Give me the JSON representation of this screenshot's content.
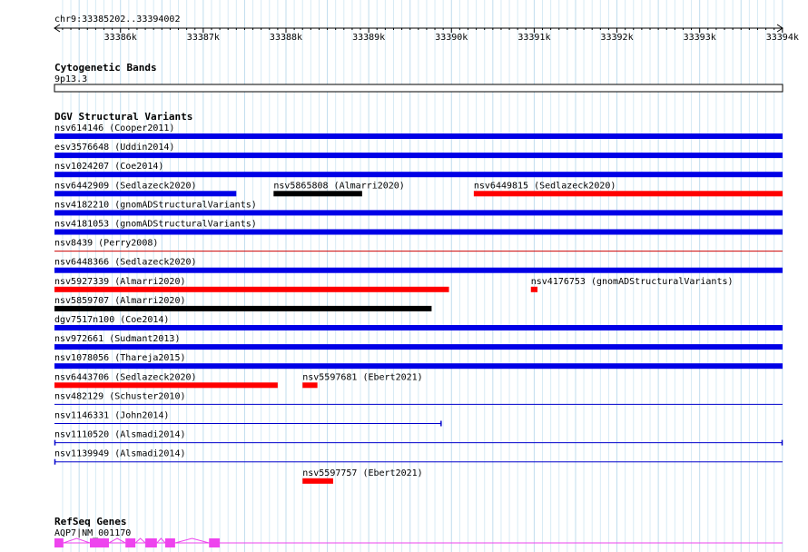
{
  "ruler": {
    "position": "chr9:33385202..33394002",
    "start": 33385202,
    "end": 33394002,
    "ticks": [
      {
        "pos": 33386000,
        "label": "33386k"
      },
      {
        "pos": 33387000,
        "label": "33387k"
      },
      {
        "pos": 33388000,
        "label": "33388k"
      },
      {
        "pos": 33389000,
        "label": "33389k"
      },
      {
        "pos": 33390000,
        "label": "33390k"
      },
      {
        "pos": 33391000,
        "label": "33391k"
      },
      {
        "pos": 33392000,
        "label": "33392k"
      },
      {
        "pos": 33393000,
        "label": "33393k"
      },
      {
        "pos": 33394000,
        "label": "33394k"
      }
    ]
  },
  "cytoband": {
    "title": "Cytogenetic Bands",
    "band": "9p13.3"
  },
  "dgv": {
    "title": "DGV Structural Variants",
    "rows": [
      {
        "features": [
          {
            "label": "nsv614146 (Cooper2011)",
            "start": 33385202,
            "end": 33394002,
            "color": "#0000e6",
            "style": "thick"
          }
        ]
      },
      {
        "features": [
          {
            "label": "esv3576648 (Uddin2014)",
            "start": 33385202,
            "end": 33394002,
            "color": "#0000e6",
            "style": "thick"
          }
        ]
      },
      {
        "features": [
          {
            "label": "nsv1024207 (Coe2014)",
            "start": 33385202,
            "end": 33394002,
            "color": "#0000e6",
            "style": "thick"
          }
        ]
      },
      {
        "features": [
          {
            "label": "nsv6442909 (Sedlazeck2020)",
            "start": 33385202,
            "end": 33387400,
            "color": "#0000e6",
            "style": "thick"
          },
          {
            "label": "nsv5865808 (Almarri2020)",
            "start": 33387850,
            "end": 33388920,
            "color": "#000000",
            "style": "thick"
          },
          {
            "label": "nsv6449815 (Sedlazeck2020)",
            "start": 33390270,
            "end": 33394002,
            "color": "#ff0000",
            "style": "thick"
          }
        ]
      },
      {
        "features": [
          {
            "label": "nsv4182210 (gnomADStructuralVariants)",
            "start": 33385202,
            "end": 33394002,
            "color": "#0000e6",
            "style": "thick"
          }
        ]
      },
      {
        "features": [
          {
            "label": "nsv4181053 (gnomADStructuralVariants)",
            "start": 33385202,
            "end": 33394002,
            "color": "#0000e6",
            "style": "thick"
          }
        ]
      },
      {
        "features": [
          {
            "label": "nsv8439 (Perry2008)",
            "start": 33385202,
            "end": 33394002,
            "color": "#cc0000",
            "style": "line"
          }
        ]
      },
      {
        "features": [
          {
            "label": "nsv6448366 (Sedlazeck2020)",
            "start": 33385202,
            "end": 33394002,
            "color": "#0000e6",
            "style": "thick"
          }
        ]
      },
      {
        "features": [
          {
            "label": "nsv5927339 (Almarri2020)",
            "start": 33385202,
            "end": 33389970,
            "color": "#ff0000",
            "style": "thick"
          },
          {
            "label": "nsv4176753 (gnomADStructuralVariants)",
            "start": 33390960,
            "end": 33391040,
            "color": "#ff0000",
            "style": "thick"
          }
        ]
      },
      {
        "features": [
          {
            "label": "nsv5859707 (Almarri2020)",
            "start": 33385202,
            "end": 33389760,
            "color": "#000000",
            "style": "thick"
          }
        ]
      },
      {
        "features": [
          {
            "label": "dgv7517n100 (Coe2014)",
            "start": 33385202,
            "end": 33394002,
            "color": "#0000e6",
            "style": "thick"
          }
        ]
      },
      {
        "features": [
          {
            "label": "nsv972661 (Sudmant2013)",
            "start": 33385202,
            "end": 33394002,
            "color": "#0000e6",
            "style": "thick"
          }
        ]
      },
      {
        "features": [
          {
            "label": "nsv1078056 (Thareja2015)",
            "start": 33385202,
            "end": 33394002,
            "color": "#0000e6",
            "style": "thick"
          }
        ]
      },
      {
        "features": [
          {
            "label": "nsv6443706 (Sedlazeck2020)",
            "start": 33385202,
            "end": 33387900,
            "color": "#ff0000",
            "style": "thick"
          },
          {
            "label": "nsv5597681 (Ebert2021)",
            "start": 33388200,
            "end": 33388380,
            "color": "#ff0000",
            "style": "thick"
          }
        ]
      },
      {
        "features": [
          {
            "label": "nsv482129 (Schuster2010)",
            "start": 33385202,
            "end": 33394002,
            "color": "#0000cc",
            "style": "line"
          }
        ]
      },
      {
        "features": [
          {
            "label": "nsv1146331 (John2014)",
            "start": 33385202,
            "end": 33389880,
            "color": "#0000cc",
            "style": "line-endcap"
          }
        ]
      },
      {
        "features": [
          {
            "label": "nsv1110520 (Alsmadi2014)",
            "start": 33385202,
            "end": 33394002,
            "color": "#0000cc",
            "style": "line-bothcaps"
          }
        ]
      },
      {
        "features": [
          {
            "label": "nsv1139949 (Alsmadi2014)",
            "start": 33385202,
            "end": 33394002,
            "color": "#0000cc",
            "style": "line-startcap"
          }
        ]
      },
      {
        "features": [
          {
            "label": "nsv5597757 (Ebert2021)",
            "start": 33388200,
            "end": 33388570,
            "color": "#ff0000",
            "style": "thick"
          }
        ]
      }
    ]
  },
  "refseq": {
    "title": "RefSeq Genes",
    "gene": {
      "label": "AQP7|NM_001170",
      "start": 33385202,
      "end": 33394002,
      "color": "#ee44ee",
      "exons": [
        [
          33385202,
          33385310
        ],
        [
          33385630,
          33385860
        ],
        [
          33386060,
          33386180
        ],
        [
          33386300,
          33386440
        ],
        [
          33386540,
          33386660
        ],
        [
          33387070,
          33387200
        ]
      ]
    }
  }
}
